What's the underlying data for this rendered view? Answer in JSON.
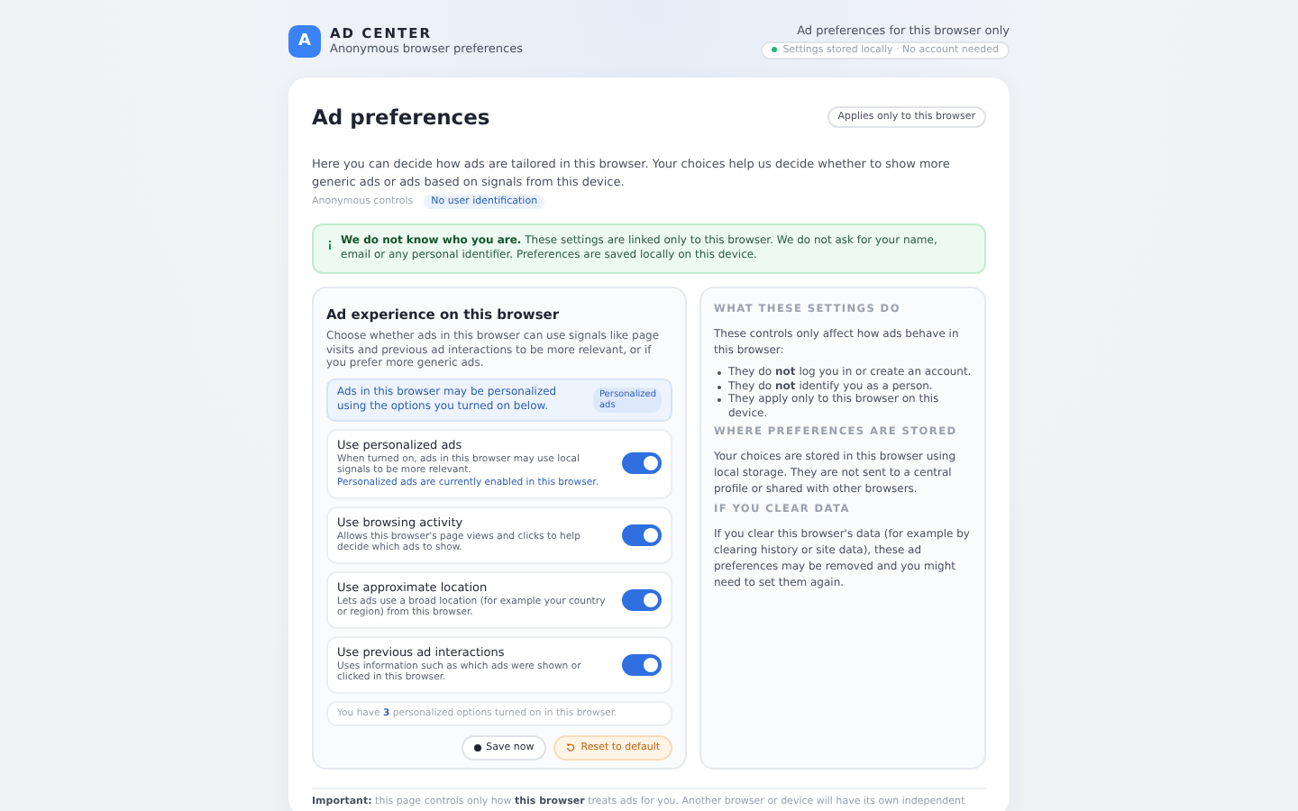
{
  "header": {
    "logo_letter": "A",
    "brand": "AD CENTER",
    "subtitle": "Anonymous browser preferences",
    "scope": "Ad preferences for this browser only",
    "status": "Settings stored locally · No account needed"
  },
  "card": {
    "title": "Ad preferences",
    "badge": "Applies only to this browser",
    "intro": "Here you can decide how ads are tailored in this browser. Your choices help us decide whether to show more generic ads or ads based on signals from this device.",
    "tags": [
      {
        "label": "Anonymous controls",
        "kind": "plain"
      },
      {
        "label": "No user identification",
        "kind": "pill"
      }
    ]
  },
  "notice": {
    "text": "**We do not know who you are.** These settings are linked only to this browser. We do not ask for your name, email or any personal identifier. Preferences are saved locally on this device."
  },
  "settings": {
    "title": "Ad experience on this browser",
    "description": "Choose whether ads in this browser can use signals like page visits and previous ad interactions to be more relevant, or if you prefer more generic ads.",
    "banner": {
      "text": "Ads in this browser may be personalized using the options you turned on below.",
      "badge": "Personalized ads"
    },
    "options": [
      {
        "label": "Use personalized ads",
        "description": "When turned on, ads in this browser may use local signals to be more relevant.",
        "note": "Personalized ads are currently enabled in this browser.",
        "on": true
      },
      {
        "label": "Use browsing activity",
        "description": "Allows this browser's page views and clicks to help decide which ads to show.",
        "on": true
      },
      {
        "label": "Use approximate location",
        "description": "Lets ads use a broad location (for example your country or region) from this browser.",
        "on": true
      },
      {
        "label": "Use previous ad interactions",
        "description": "Uses information such as which ads were shown or clicked in this browser.",
        "on": true
      }
    ],
    "summary": "You have **3** personalized options turned on in this browser.",
    "buttons": [
      {
        "label": "Save now",
        "kind": "save"
      },
      {
        "label": "Reset to default",
        "kind": "reset"
      }
    ]
  },
  "info": {
    "sections": [
      {
        "heading": "WHAT THESE SETTINGS DO",
        "paragraph": "These controls only affect how ads behave in this browser:",
        "bullets": [
          "They do **not** log you in or create an account.",
          "They do **not** identify you as a person.",
          "They apply only to this browser on this device."
        ]
      },
      {
        "heading": "WHERE PREFERENCES ARE STORED",
        "paragraph": "Your choices are stored in this browser using local storage. They are not sent to a central profile or shared with other browsers."
      },
      {
        "heading": "IF YOU CLEAR DATA",
        "paragraph": "If you clear this browser's data (for example by clearing history or site data), these ad preferences may be removed and you might need to set them again."
      }
    ]
  },
  "footer": "**Important:** this page controls only how **this browser** treats ads for you. Another browser or device will have its own independent"
}
